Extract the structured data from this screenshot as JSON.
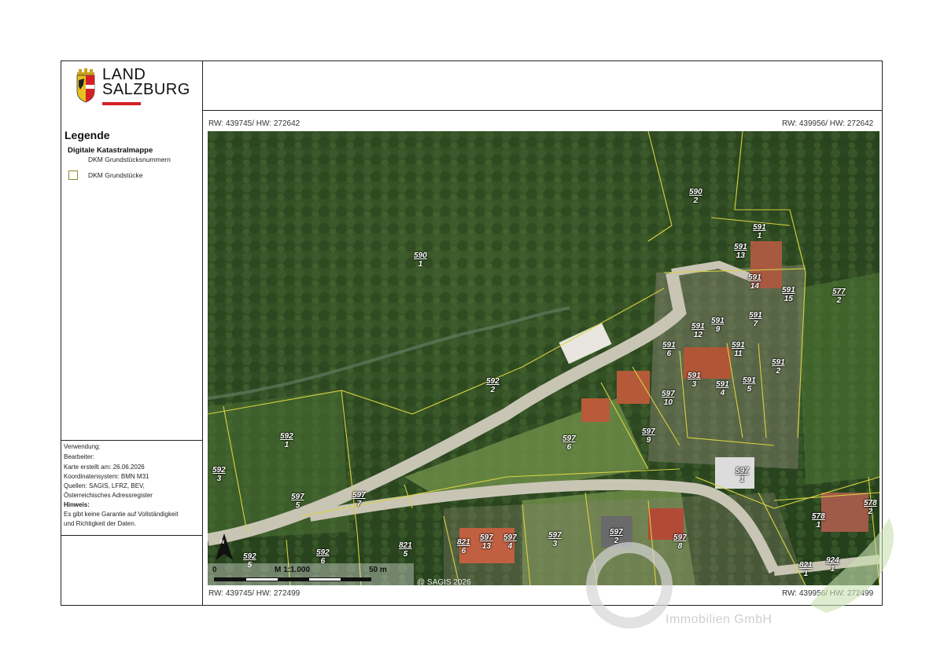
{
  "brand": {
    "line1": "LAND",
    "line2": "SALZBURG",
    "red": "#d42026"
  },
  "legend": {
    "title": "Legende",
    "section": "Digitale Katastralmappe",
    "line_item": "DKM Grundstücksnummern",
    "box_item": "DKM Grundstücke"
  },
  "meta": {
    "usage": "Verwendung:",
    "editor": "Bearbeiter:",
    "created": "Karte erstellt am: 26.06.2026",
    "crs": "Koordinatensystem: BMN M31",
    "sources": "Quellen: SAGIS, LFRZ, BEV,",
    "registry": "Österreichisches Adressregister",
    "note_label": "Hinweis:",
    "note1": "Es gibt keine Garantie auf Vollständigkeit",
    "note2": "und Richtigkeit der Daten."
  },
  "coords": {
    "top_left": "RW: 439745/ HW: 272642",
    "top_right": "RW: 439956/ HW: 272642",
    "bottom_left": "RW: 439745/ HW: 272499",
    "bottom_right": "RW: 439956/ HW: 272499"
  },
  "scale": {
    "zero": "0",
    "ratio": "M 1:1.000",
    "distance": "50 m",
    "north": "N"
  },
  "copyright": "@ SAGIS 2026",
  "watermark": "Immobilien GmbH",
  "parcels": [
    {
      "num": "590",
      "sub": "2"
    },
    {
      "num": "590",
      "sub": "1"
    },
    {
      "num": "591",
      "sub": "1"
    },
    {
      "num": "591",
      "sub": "13"
    },
    {
      "num": "591",
      "sub": "14"
    },
    {
      "num": "591",
      "sub": "15"
    },
    {
      "num": "577",
      "sub": "2"
    },
    {
      "num": "591",
      "sub": "7"
    },
    {
      "num": "591",
      "sub": "9"
    },
    {
      "num": "591",
      "sub": "12"
    },
    {
      "num": "591",
      "sub": "6"
    },
    {
      "num": "591",
      "sub": "11"
    },
    {
      "num": "591",
      "sub": "2"
    },
    {
      "num": "591",
      "sub": "3"
    },
    {
      "num": "591",
      "sub": "4"
    },
    {
      "num": "591",
      "sub": "5"
    },
    {
      "num": "597",
      "sub": "10"
    },
    {
      "num": "592",
      "sub": "2"
    },
    {
      "num": "597",
      "sub": "6"
    },
    {
      "num": "597",
      "sub": "9"
    },
    {
      "num": "592",
      "sub": "1"
    },
    {
      "num": "592",
      "sub": "3"
    },
    {
      "num": "597",
      "sub": "1"
    },
    {
      "num": "578",
      "sub": "2"
    },
    {
      "num": "597",
      "sub": "5"
    },
    {
      "num": "597",
      "sub": "7"
    },
    {
      "num": "578",
      "sub": "1"
    },
    {
      "num": "821",
      "sub": "6"
    },
    {
      "num": "597",
      "sub": "13"
    },
    {
      "num": "597",
      "sub": "4"
    },
    {
      "num": "597",
      "sub": "3"
    },
    {
      "num": "597",
      "sub": "2"
    },
    {
      "num": "597",
      "sub": "8"
    },
    {
      "num": "592",
      "sub": "5"
    },
    {
      "num": "592",
      "sub": "6"
    },
    {
      "num": "821",
      "sub": "5"
    },
    {
      "num": "821",
      "sub": "1"
    },
    {
      "num": "924",
      "sub": "1"
    }
  ]
}
